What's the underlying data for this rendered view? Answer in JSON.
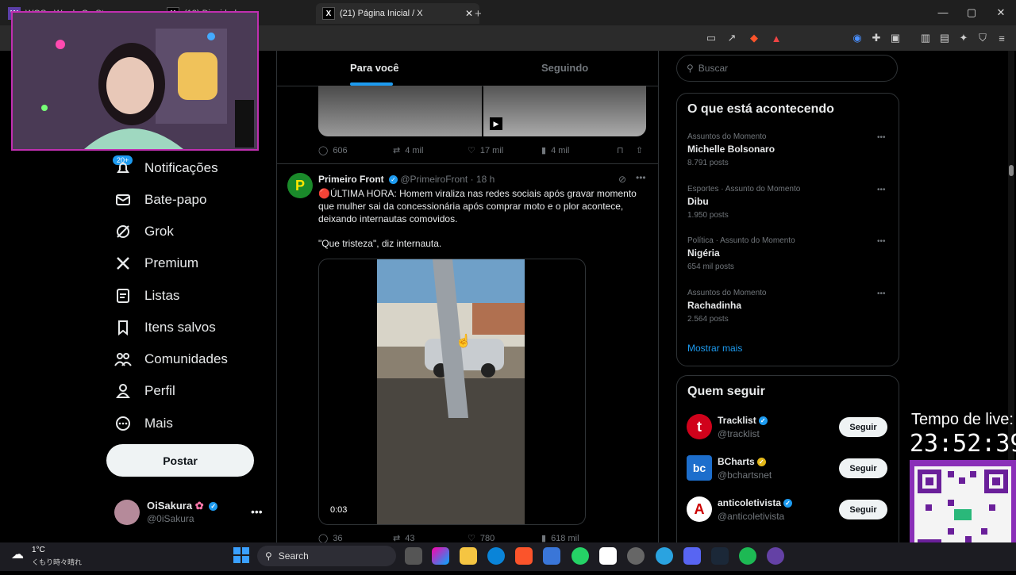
{
  "browser": {
    "tabs": [
      {
        "label": "WOS - Words On Stream"
      },
      {
        "label": "(13) Dignidade"
      },
      {
        "label": "(21) Página Inicial / X"
      }
    ],
    "new_tab": "+",
    "window_controls": [
      "—",
      "▢",
      "✕"
    ]
  },
  "sidebar": {
    "notifications_badge": "20+",
    "items": [
      {
        "label": "Notificações",
        "icon": "bell-icon"
      },
      {
        "label": "Bate-papo",
        "icon": "mail-icon"
      },
      {
        "label": "Grok",
        "icon": "grok-icon"
      },
      {
        "label": "Premium",
        "icon": "x-logo-icon"
      },
      {
        "label": "Listas",
        "icon": "list-icon"
      },
      {
        "label": "Itens salvos",
        "icon": "bookmark-icon"
      },
      {
        "label": "Comunidades",
        "icon": "people-icon"
      },
      {
        "label": "Perfil",
        "icon": "person-icon"
      },
      {
        "label": "Mais",
        "icon": "more-circle-icon"
      }
    ],
    "post_button": "Postar",
    "account": {
      "name": "OiSakura",
      "handle": "@0iSakura"
    }
  },
  "feed": {
    "tabs": [
      "Para você",
      "Seguindo"
    ],
    "prev_post_stats": {
      "replies": "606",
      "reposts": "4 mil",
      "likes": "17 mil",
      "views": "4 mil"
    },
    "post": {
      "author": "Primeiro Front",
      "handle": "@PrimeiroFront",
      "time": "· 18 h",
      "text1": "🔴ÚLTIMA HORA: Homem viraliza nas redes sociais após gravar momento que mulher sai da concessionária após comprar moto e o plor acontece, deixando internautas comovidos.",
      "text2": "\"Que tristeza\", diz internauta.",
      "video_time": "0:03",
      "stats": {
        "replies": "36",
        "reposts": "43",
        "likes": "780",
        "views": "618 mil"
      }
    }
  },
  "right": {
    "search_placeholder": "Buscar",
    "trends_title": "O que está acontecendo",
    "trends": [
      {
        "context": "Assuntos do Momento",
        "title": "Michelle Bolsonaro",
        "count": "8.791 posts"
      },
      {
        "context": "Esportes · Assunto do Momento",
        "title": "Dibu",
        "count": "1.950 posts"
      },
      {
        "context": "Política · Assunto do Momento",
        "title": "Nigéria",
        "count": "654 mil posts"
      },
      {
        "context": "Assuntos do Momento",
        "title": "Rachadinha",
        "count": "2.564 posts"
      }
    ],
    "show_more": "Mostrar mais",
    "who_to_follow_title": "Quem seguir",
    "follow": [
      {
        "name": "Tracklist",
        "handle": "@tracklist",
        "button": "Seguir"
      },
      {
        "name": "BCharts",
        "handle": "@bchartsnet",
        "button": "Seguir"
      },
      {
        "name": "anticoletivista",
        "handle": "@anticoletivista",
        "button": "Seguir"
      }
    ]
  },
  "overlay": {
    "live_label": "Tempo de live:",
    "live_time": "23:52:39"
  },
  "taskbar": {
    "weather_temp": "1°C",
    "weather_desc": "くもり時々晴れ",
    "search": "Search"
  }
}
